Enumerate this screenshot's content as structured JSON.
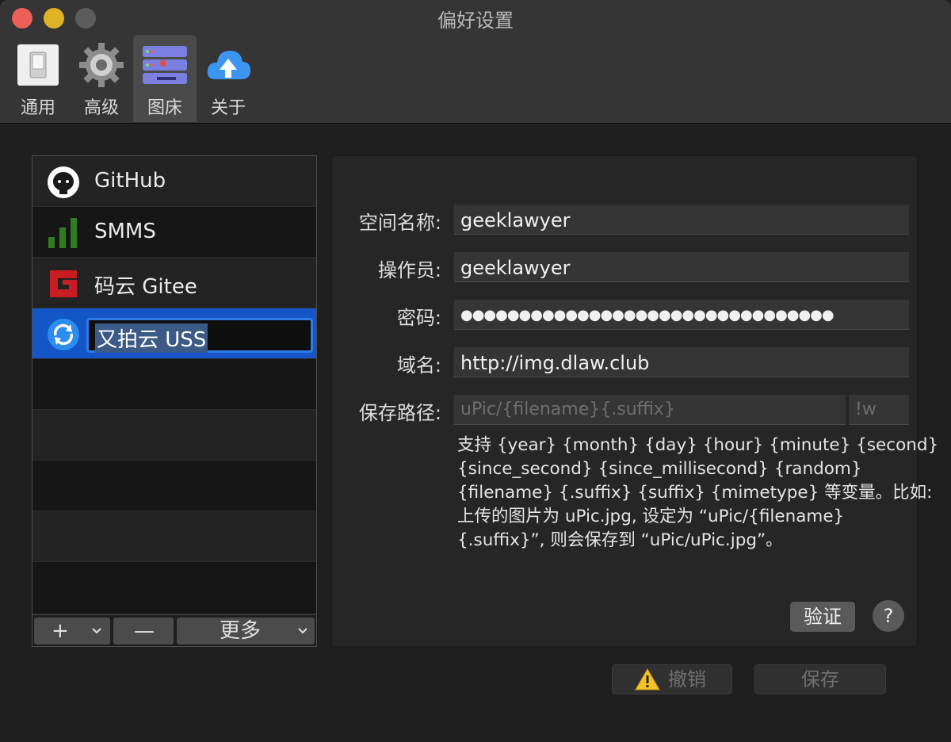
{
  "window": {
    "title": "偏好设置"
  },
  "tabs": [
    {
      "label": "通用",
      "icon": "switch-icon"
    },
    {
      "label": "高级",
      "icon": "gear-icon"
    },
    {
      "label": "图床",
      "icon": "server-icon",
      "active": true
    },
    {
      "label": "关于",
      "icon": "cloud-upload-icon"
    }
  ],
  "hosts": [
    {
      "label": "GitHub",
      "icon": "github-icon"
    },
    {
      "label": "SMMS",
      "icon": "signal-bars-icon"
    },
    {
      "label": "码云 Gitee",
      "icon": "gitee-icon"
    },
    {
      "label": "又拍云 USS",
      "icon": "upyun-icon",
      "selected": true,
      "editing": true
    }
  ],
  "list_bar": {
    "add": "+",
    "remove": "—",
    "more": "更多"
  },
  "form": {
    "bucket_label": "空间名称:",
    "bucket_value": "geeklawyer",
    "operator_label": "操作员:",
    "operator_value": "geeklawyer",
    "password_label": "密码:",
    "password_value": "●●●●●●●●●●●●●●●●●●●●●●●●●●●●●●●●",
    "domain_label": "域名:",
    "domain_value": "http://img.dlaw.club",
    "path_label": "保存路径:",
    "path_placeholder": "uPic/{filename}{.suffix}",
    "suffix_placeholder": "!w",
    "help_lines": [
      "支持 {year} {month} {day} {hour} {minute} {second}",
      "{since_second} {since_millisecond} {random}",
      "{filename} {.suffix} {suffix} {mimetype} 等变量。比如:",
      "上传的图片为 uPic.jpg, 设定为 “uPic/{filename}",
      "{.suffix}”, 则会保存到 “uPic/uPic.jpg”。"
    ],
    "verify_label": "验证",
    "help_button": "?"
  },
  "footer": {
    "revert_label": "撤销",
    "save_label": "保存"
  },
  "colors": {
    "selection": "#1455c8",
    "accent": "#2f7be8"
  }
}
